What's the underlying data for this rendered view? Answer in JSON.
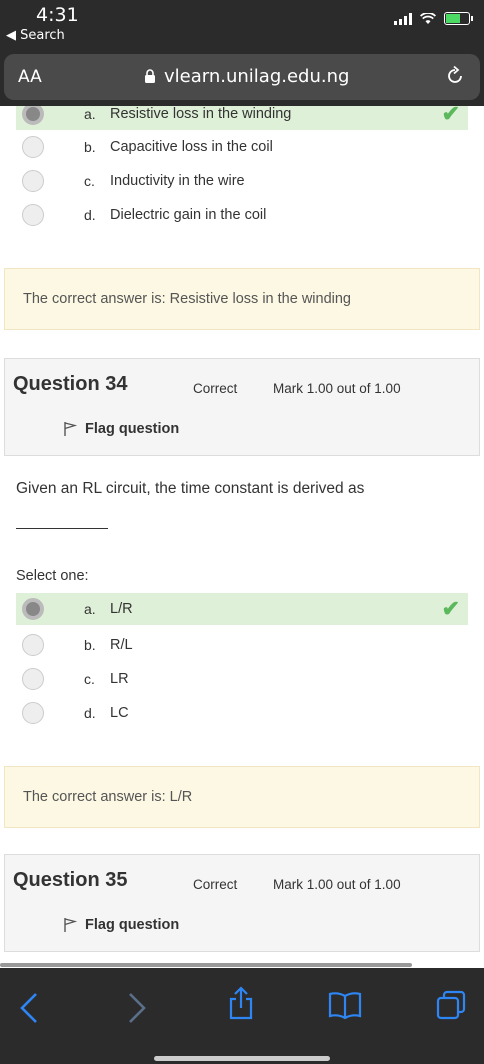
{
  "status": {
    "time": "4:31",
    "back_label": "◀ Search"
  },
  "browser": {
    "aa": "AA",
    "url": "vlearn.unilag.edu.ng"
  },
  "q33": {
    "options": [
      {
        "letter": "a.",
        "text": "Resistive loss in the winding"
      },
      {
        "letter": "b.",
        "text": "Capacitive loss in the coil"
      },
      {
        "letter": "c.",
        "text": "Inductivity in the wire"
      },
      {
        "letter": "d.",
        "text": "Dielectric gain in the coil"
      }
    ],
    "answer": "The correct answer is: Resistive loss in the winding"
  },
  "q34": {
    "title": "Question 34",
    "state": "Correct",
    "mark": "Mark 1.00 out of 1.00",
    "flag": "Flag question",
    "text": "Given an RL circuit, the time constant is derived as",
    "select_one": "Select one:",
    "options": [
      {
        "letter": "a.",
        "text": "L/R"
      },
      {
        "letter": "b.",
        "text": "R/L"
      },
      {
        "letter": "c.",
        "text": "LR"
      },
      {
        "letter": "d.",
        "text": "LC"
      }
    ],
    "answer": "The correct answer is: L/R"
  },
  "q35": {
    "title": "Question 35",
    "state": "Correct",
    "mark": "Mark 1.00 out of 1.00",
    "flag": "Flag question"
  },
  "toolbar": {
    "back": "‹",
    "forward": "›"
  },
  "colors": {
    "correct_bg": "#dff0d8",
    "answer_bg": "#fcf8e3",
    "accent": "#2e86f5",
    "check": "#5cb85c"
  }
}
